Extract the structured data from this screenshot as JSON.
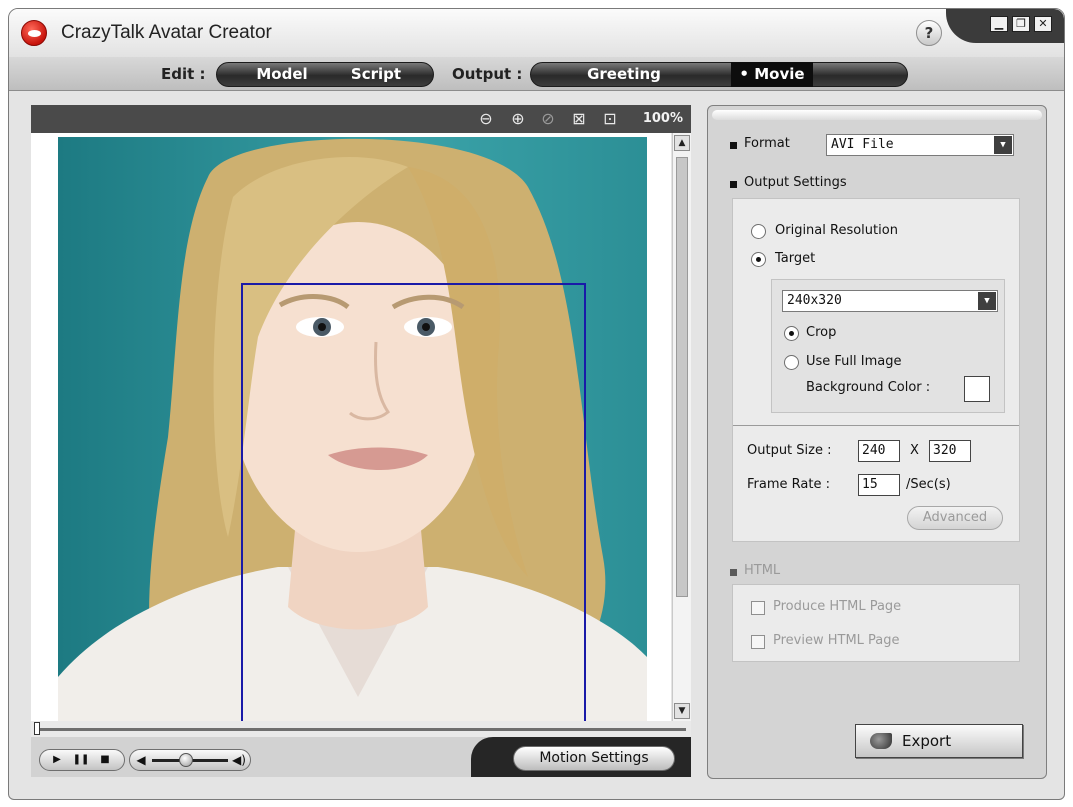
{
  "window": {
    "title": "CrazyTalk Avatar Creator",
    "help": "?",
    "controls": {
      "minimize": "▁",
      "restore": "❐",
      "close": "✕"
    }
  },
  "nav": {
    "edit_label": "Edit :",
    "edit_tabs": [
      {
        "label": "Model"
      },
      {
        "label": "Script"
      }
    ],
    "output_label": "Output :",
    "output_tabs": [
      {
        "label": "Greeting"
      },
      {
        "label": "Movie",
        "active": true
      }
    ],
    "active_marker": "•"
  },
  "viewer": {
    "toolbar_icons": [
      "zoom-out-icon",
      "zoom-in-icon",
      "no-icon",
      "fit-icon",
      "actual-size-icon"
    ],
    "zoom": "100%"
  },
  "playback": {
    "timeline_position": 0,
    "volume": 0.45,
    "motion_settings_label": "Motion Settings"
  },
  "panel": {
    "format_label": "Format",
    "format_value": "AVI File",
    "output_settings_label": "Output Settings",
    "original_resolution_label": "Original Resolution",
    "target_label": "Target",
    "target_selected": true,
    "target_value": "240x320",
    "crop_label": "Crop",
    "crop_selected": true,
    "full_image_label": "Use Full Image",
    "background_color_label": "Background Color :",
    "background_color": "#ffffff",
    "output_size_label": "Output Size :",
    "output_width": "240",
    "x_label": "X",
    "output_height": "320",
    "frame_rate_label": "Frame Rate :",
    "frame_rate": "15",
    "frame_rate_unit": "/Sec(s)",
    "advanced_label": "Advanced",
    "html_label": "HTML",
    "produce_html_label": "Produce HTML Page",
    "preview_html_label": "Preview HTML Page",
    "export_label": "Export"
  }
}
